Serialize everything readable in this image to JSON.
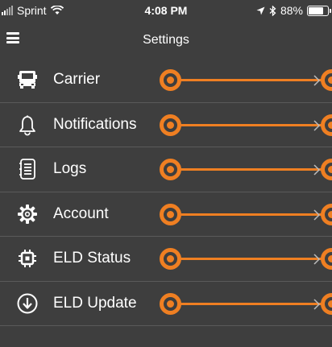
{
  "status_bar": {
    "carrier": "Sprint",
    "time": "4:08 PM",
    "battery": "88%",
    "battery_level": 0.88,
    "icons": [
      "signal-icon",
      "wifi-icon",
      "location-arrow-icon",
      "bluetooth-icon",
      "battery-icon"
    ]
  },
  "nav": {
    "title": "Settings",
    "menu_icon": "hamburger-menu-icon"
  },
  "settings": {
    "items": [
      {
        "label": "Carrier",
        "icon": "truck-icon"
      },
      {
        "label": "Notifications",
        "icon": "bell-icon"
      },
      {
        "label": "Logs",
        "icon": "log-list-icon"
      },
      {
        "label": "Account",
        "icon": "gear-icon"
      },
      {
        "label": "ELD Status",
        "icon": "chip-icon"
      },
      {
        "label": "ELD Update",
        "icon": "download-circle-icon"
      }
    ],
    "chevron_icon": "chevron-right-icon"
  },
  "colors": {
    "background": "#3e3e3e",
    "accent": "#ef7f22",
    "text": "#ffffff",
    "divider": "#5a5a5a"
  }
}
